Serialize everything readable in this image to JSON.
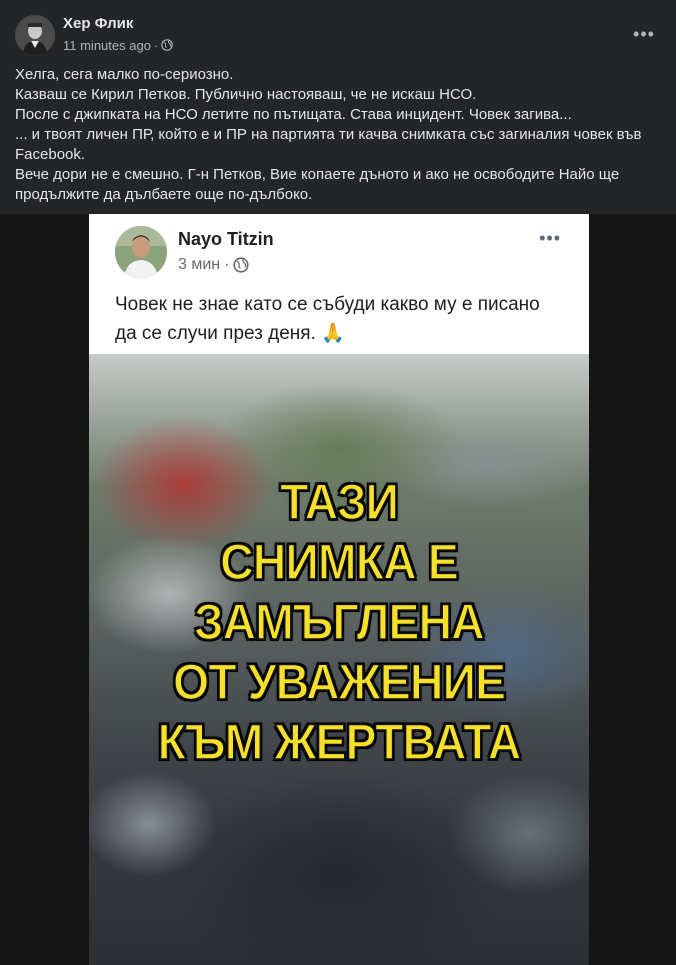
{
  "post": {
    "author": "Хер Флик",
    "time": "11 minutes ago",
    "separator": "·",
    "privacy_icon": "globe-icon",
    "more_label": "•••",
    "text_lines": [
      "Хелга, сега малко по-сериозно.",
      "Казваш се Кирил Петков. Публично настояваш, че не искаш НСО.",
      "После с джипката на НСО летите по пътищата. Става инцидент. Човек загива...",
      "... и твоят личен ПР, който е и ПР на партията ти качва снимката със загиналия човек във Facebook.",
      "Вече дори не е смешно. Г-н Петков, Вие копаете дъното и ако не освободите Найо ще продължите да дълбаете още по-дълбоко."
    ]
  },
  "shared_screenshot": {
    "author": "Nayo Titzin",
    "time": "3 мин",
    "separator": "·",
    "more_label": "•••",
    "text": "Човек не знае като се събуди какво му е писано да се случи през деня.",
    "emoji": "🙏",
    "overlay_lines": [
      "ТАЗИ",
      "СНИМКА Е",
      "ЗАМЪГЛЕНА",
      "ОТ УВАЖЕНИЕ",
      "КЪМ ЖЕРТВАТА"
    ]
  },
  "colors": {
    "card_bg": "#242526",
    "primary_text": "#e4e6eb",
    "secondary_text": "#b0b3b8",
    "overlay_text": "#f6e02a"
  }
}
